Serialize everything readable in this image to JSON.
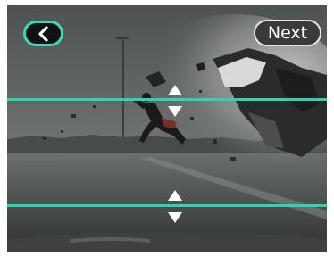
{
  "toolbar": {
    "back_icon": "chevron-left-icon",
    "next_label": "Next"
  },
  "trim": {
    "accent_color": "#2fd4ae",
    "handle_icons": [
      "triangle-up-icon",
      "triangle-down-icon"
    ]
  },
  "colors": {
    "accent": "#3fd8b5",
    "button_background": "#111111",
    "next_border": "#e6e6e6"
  }
}
